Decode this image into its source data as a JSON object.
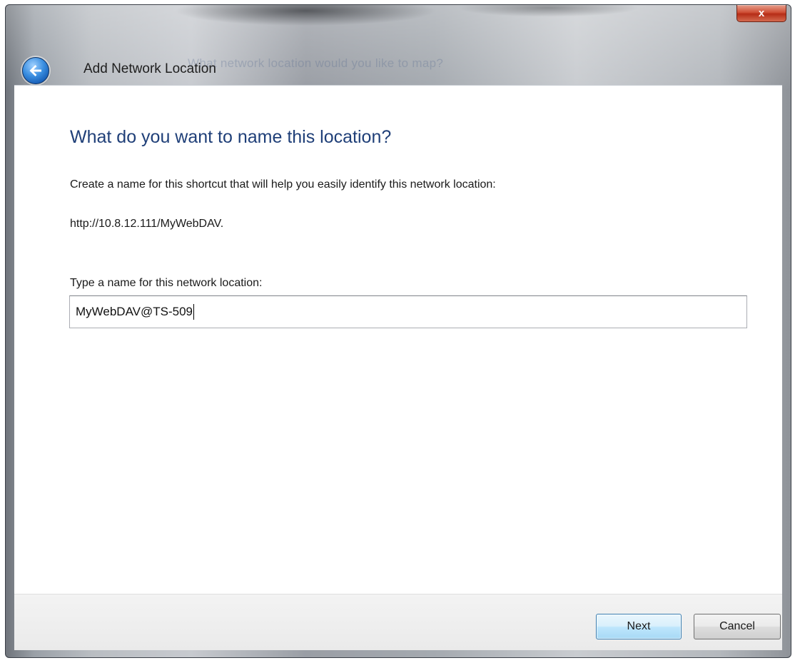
{
  "window": {
    "title": "Add Network Location",
    "ghost_title": "What network location would you like to map?",
    "close_glyph": "x"
  },
  "main": {
    "heading": "What do you want to name this location?",
    "instruction": "Create a name for this shortcut that will help you easily identify this network location:",
    "url": "http://10.8.12.111/MyWebDAV.",
    "field_label": "Type a name for this network location:",
    "name_value": "MyWebDAV@TS-509"
  },
  "footer": {
    "next_label": "Next",
    "cancel_label": "Cancel"
  },
  "icons": {
    "back": "back-arrow-icon",
    "close": "close-icon"
  },
  "colors": {
    "heading": "#1f3f78",
    "close_button": "#c4391f",
    "back_button": "#2a78cf"
  }
}
